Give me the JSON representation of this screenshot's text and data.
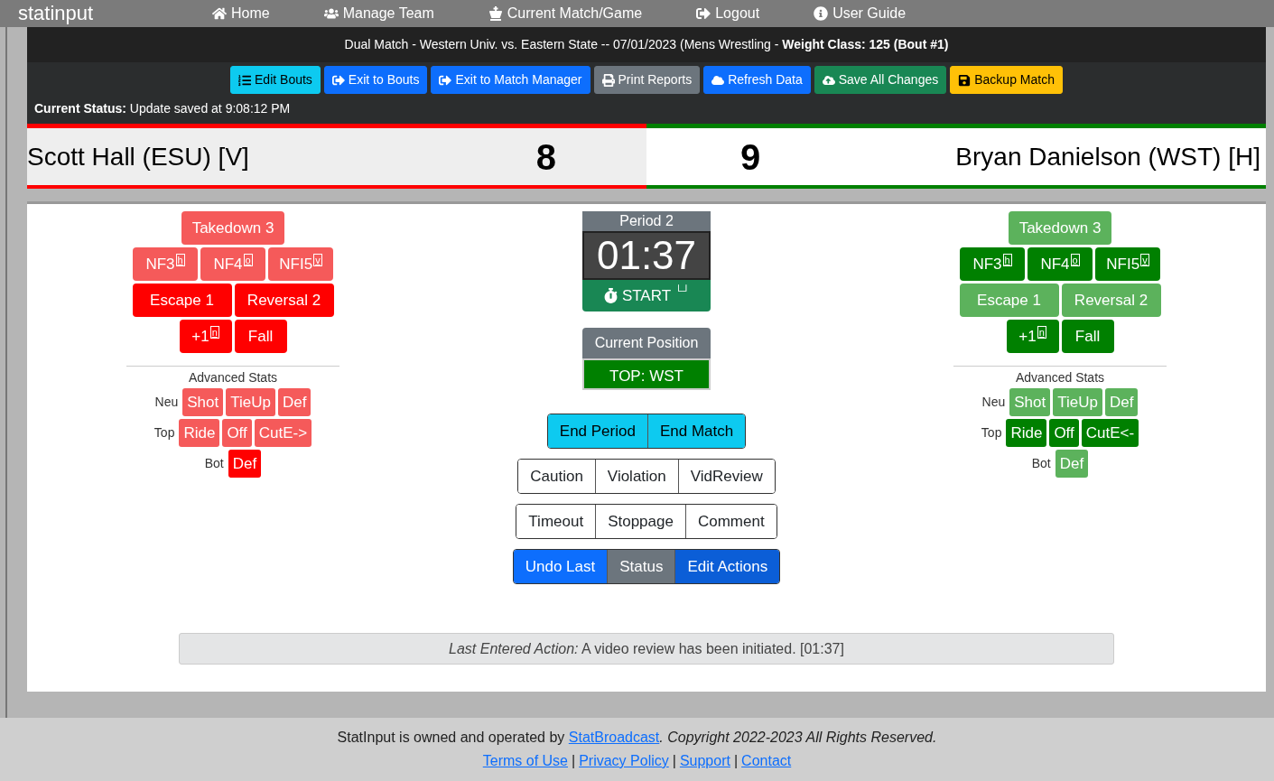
{
  "nav": {
    "brand": "statinput",
    "items": [
      {
        "label": "Home"
      },
      {
        "label": "Manage Team"
      },
      {
        "label": "Current Match/Game"
      },
      {
        "label": "Logout"
      },
      {
        "label": "User Guide"
      }
    ]
  },
  "header": {
    "title": "Dual Match - Western Univ. vs. Eastern State -- 07/01/2023 (Mens Wrestling - **Weight Class: 125 (Bout #1)**",
    "buttons": [
      {
        "label": "Edit Bouts",
        "kind": "info"
      },
      {
        "label": "Exit to Bouts",
        "kind": "primary"
      },
      {
        "label": "Exit to Match Manager",
        "kind": "primary"
      },
      {
        "label": "Print Reports",
        "kind": "secondary"
      },
      {
        "label": "Refresh Data",
        "kind": "primary"
      },
      {
        "label": "Save All Changes",
        "kind": "success"
      },
      {
        "label": "Backup Match",
        "kind": "warning"
      }
    ],
    "status_label": "Current Status:",
    "status": "Update saved at 9:08:12 PM"
  },
  "score": {
    "left": {
      "name": "Scott Hall (ESU) [V]",
      "points": "8",
      "color": "#ff0000"
    },
    "right": {
      "name": "Bryan Danielson (WST) [H]",
      "points": "9",
      "color": "#008000"
    }
  },
  "sides": [
    {
      "rows": [
        [
          {
            "label": "Takedown 3",
            "highlighted": false
          }
        ],
        [
          {
            "label": "NF3",
            "key": "h",
            "highlighted": false
          },
          {
            "label": "NF4",
            "key": "o",
            "highlighted": false
          },
          {
            "label": "NFI5",
            "key": "v",
            "highlighted": false
          }
        ],
        [
          {
            "label": "Escape 1",
            "highlighted": true
          },
          {
            "label": "Reversal 2",
            "highlighted": true
          }
        ],
        [
          {
            "label": "+1",
            "key": "n",
            "highlighted": true
          },
          {
            "label": "Fall",
            "highlighted": true
          }
        ]
      ],
      "advanced_title": "Advanced Stats",
      "advanced": [
        {
          "label": "Neu",
          "buttons": [
            {
              "label": "Shot",
              "highlighted": false
            },
            {
              "label": "TieUp",
              "highlighted": false
            },
            {
              "label": "Def",
              "highlighted": false
            }
          ]
        },
        {
          "label": "Top",
          "buttons": [
            {
              "label": "Ride",
              "highlighted": false
            },
            {
              "label": "Off",
              "highlighted": false
            },
            {
              "label": "CutE->",
              "highlighted": false
            }
          ]
        },
        {
          "label": "Bot",
          "buttons": [
            {
              "label": "Def",
              "highlighted": true
            }
          ]
        }
      ]
    },
    {
      "rows": [
        [
          {
            "label": "Takedown 3",
            "highlighted": false
          }
        ],
        [
          {
            "label": "NF3",
            "key": "h",
            "highlighted": true
          },
          {
            "label": "NF4",
            "key": "o",
            "highlighted": true
          },
          {
            "label": "NFI5",
            "key": "v",
            "highlighted": true
          }
        ],
        [
          {
            "label": "Escape 1",
            "highlighted": false
          },
          {
            "label": "Reversal 2",
            "highlighted": false
          }
        ],
        [
          {
            "label": "+1",
            "key": "n",
            "highlighted": true
          },
          {
            "label": "Fall",
            "highlighted": true
          }
        ]
      ],
      "advanced_title": "Advanced Stats",
      "advanced": [
        {
          "label": "Neu",
          "buttons": [
            {
              "label": "Shot",
              "highlighted": false
            },
            {
              "label": "TieUp",
              "highlighted": false
            },
            {
              "label": "Def",
              "highlighted": false
            }
          ]
        },
        {
          "label": "Top",
          "buttons": [
            {
              "label": "Ride",
              "highlighted": true
            },
            {
              "label": "Off",
              "highlighted": true
            },
            {
              "label": "CutE<-",
              "highlighted": true
            }
          ]
        },
        {
          "label": "Bot",
          "buttons": [
            {
              "label": "Def",
              "highlighted": false
            }
          ]
        }
      ]
    }
  ],
  "clock": {
    "period": "Period 2",
    "time": "01:37",
    "start": "START",
    "start_key": "└┘"
  },
  "position": {
    "title": "Current Position",
    "value": "TOP: WST"
  },
  "groups": [
    [
      {
        "label": "End Period",
        "kind": "info"
      },
      {
        "label": "End Match",
        "kind": "info"
      }
    ],
    [
      {
        "label": "Caution",
        "kind": "outline"
      },
      {
        "label": "Violation",
        "kind": "outline"
      },
      {
        "label": "VidReview",
        "kind": "outline"
      }
    ],
    [
      {
        "label": "Timeout",
        "kind": "outline"
      },
      {
        "label": "Stoppage",
        "kind": "outline"
      },
      {
        "label": "Comment",
        "kind": "outline"
      }
    ],
    [
      {
        "label": "Undo Last",
        "kind": "primary"
      },
      {
        "label": "Status",
        "kind": "secondary"
      },
      {
        "label": "Edit Actions",
        "kind": "primarydark"
      }
    ]
  ],
  "last_action": {
    "label": "Last Entered Action:",
    "text": "A video review has been initiated. [01:37]"
  },
  "footer": {
    "before": "StatInput is owned and operated by ",
    "link": "StatBroadcast",
    "after": ". Copyright 2022-2023 All Rights Reserved.",
    "links": [
      {
        "text": "Terms of Use"
      },
      {
        "separator": "|",
        "text": "Privacy Policy"
      },
      {
        "separator": "|",
        "text": "Support"
      },
      {
        "separator": "|",
        "text": "Contact"
      }
    ]
  }
}
